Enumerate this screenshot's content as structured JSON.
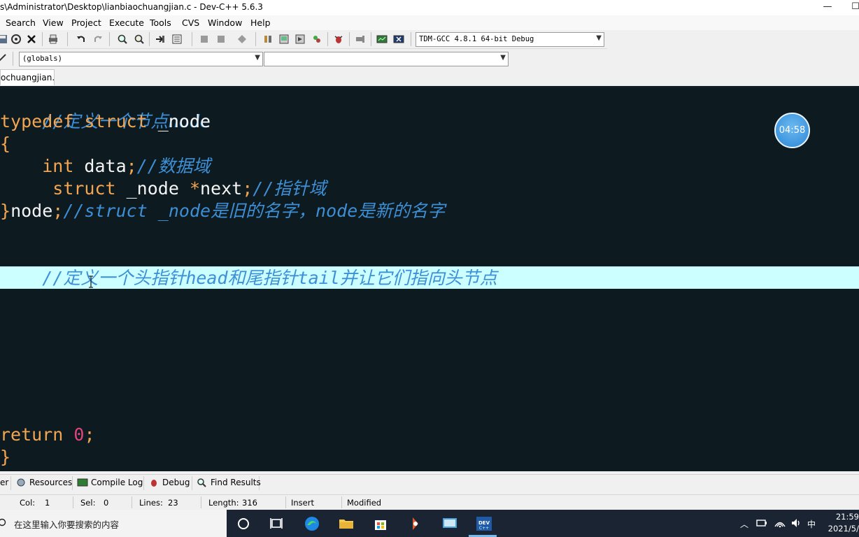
{
  "window": {
    "title": "s\\Administrator\\Desktop\\lianbiaochuangjian.c - Dev-C++ 5.6.3",
    "minimize_glyph": "—",
    "restore_glyph": "☐"
  },
  "menu": [
    "Search",
    "View",
    "Project",
    "Execute",
    "Tools",
    "CVS",
    "Window",
    "Help"
  ],
  "toolbar": {
    "compiler": "TDM-GCC 4.8.1 64-bit Debug",
    "scope": "(globals)",
    "function": ""
  },
  "tab": {
    "filename": "ochuangjian.c"
  },
  "editor": {
    "lines": [
      {
        "comment": "//定义一个节点node"
      },
      {
        "kw1": "typedef",
        "kw2": "struct",
        "rest": " _node"
      },
      {
        "brace": "{"
      },
      {
        "indent": "    ",
        "kw": "int",
        "rest": " data",
        "semi": ";",
        "comment": "//数据域"
      },
      {
        "indent": "     ",
        "kw": "struct",
        "rest": " _node ",
        "star": "*",
        "rest2": "next",
        "semi": ";",
        "comment": "//指针域"
      },
      {
        "brace": "}",
        "rest": "node",
        "semi": ";",
        "comment": "//struct _node是旧的名字，node是新的名字"
      },
      {
        "comment": "//定义一个头指针head和尾指针tail并让它们指向头节点"
      },
      {
        "kw": "return",
        "num": "0",
        "semi": ";"
      },
      {
        "brace": "}"
      }
    ],
    "timer": "04:58"
  },
  "bottom_tabs": [
    "er",
    "Resources",
    "Compile Log",
    "Debug",
    "Find Results"
  ],
  "status": {
    "col_label": "Col:",
    "col": "1",
    "sel_label": "Sel:",
    "sel": "0",
    "lines_label": "Lines:",
    "lines": "23",
    "length_label": "Length:",
    "length": "316",
    "mode": "Insert",
    "state": "Modified"
  },
  "taskbar": {
    "search_placeholder": "在这里输入你要搜索的内容",
    "ime": "中",
    "time": "21:59",
    "date": "2021/5/"
  }
}
